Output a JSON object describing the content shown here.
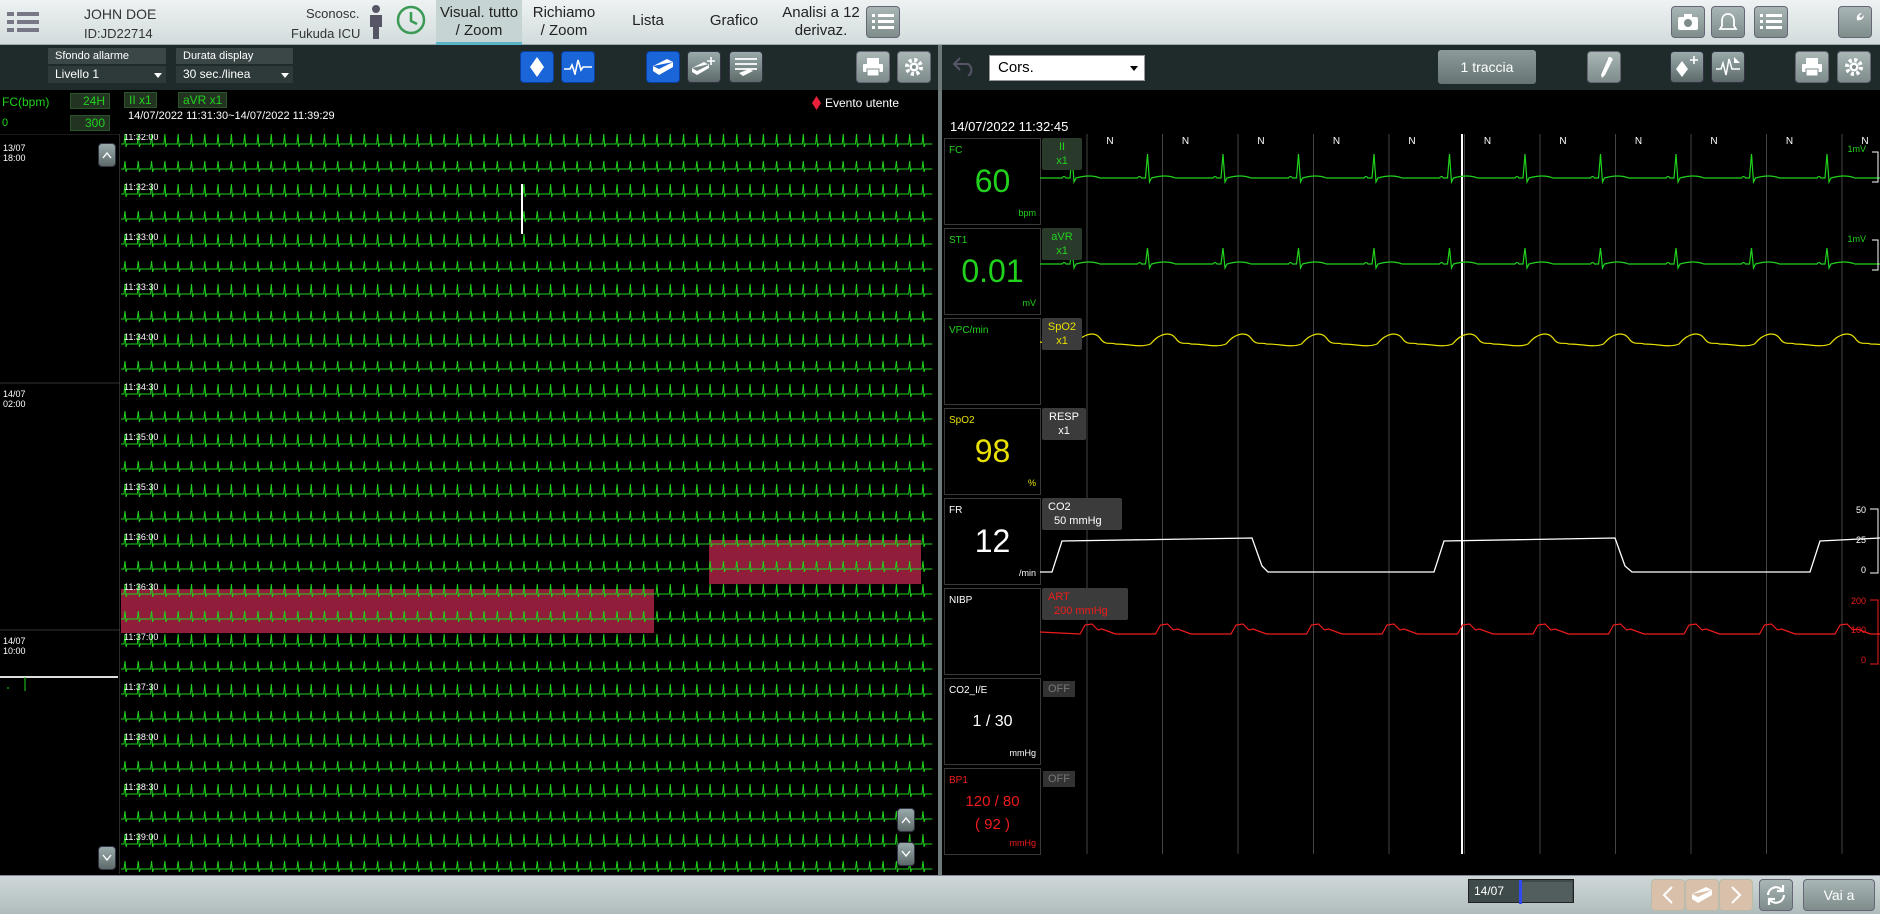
{
  "header": {
    "patient_name": "JOHN DOE",
    "patient_id": "ID:JD22714",
    "gender": "Sconosc.",
    "location": "Fukuda ICU",
    "tabs": [
      {
        "label1": "Visual. tutto",
        "label2": "/ Zoom"
      },
      {
        "label1": "Richiamo",
        "label2": "/ Zoom"
      },
      {
        "label1": "Lista",
        "label2": ""
      },
      {
        "label1": "Grafico",
        "label2": ""
      },
      {
        "label1": "Analisi a 12",
        "label2": "derivaz."
      }
    ]
  },
  "left": {
    "alarm_bg_label": "Sfondo allarme",
    "alarm_bg_value": "Livello 1",
    "display_dur_label": "Durata display",
    "display_dur_value": "30 sec./linea",
    "hr_label": "FC(bpm)",
    "hr_range_btn": "24H",
    "hr_min": "0",
    "hr_max": "300",
    "lead1": "II  x1",
    "lead2": "aVR  x1",
    "time_range": "14/07/2022 11:31:30~14/07/2022 11:39:29",
    "event_legend": "Evento utente",
    "trend_labels": [
      {
        "date": "13/07",
        "time": "18:00"
      },
      {
        "date": "14/07",
        "time": "02:00"
      },
      {
        "date": "14/07",
        "time": "10:00"
      }
    ],
    "row_times": [
      "11:32:00",
      "11:32:30",
      "11:33:00",
      "11:33:30",
      "11:34:00",
      "11:34:30",
      "11:35:00",
      "11:35:30",
      "11:36:00",
      "11:36:30",
      "11:37:00",
      "11:37:30",
      "11:38:00",
      "11:38:30",
      "11:39:00"
    ]
  },
  "right": {
    "trace_select": "Cors.",
    "trace_btn": "1 traccia",
    "timestamp": "14/07/2022 11:32:45",
    "beat_marker": "N",
    "params": [
      {
        "name": "FC",
        "value": "60",
        "unit": "bpm",
        "color": "#21d21d"
      },
      {
        "name": "ST1",
        "value": "0.01",
        "unit": "mV",
        "color": "#21d21d"
      },
      {
        "name": "VPC/min",
        "value": "",
        "unit": "",
        "color": "#21d21d"
      },
      {
        "name": "SpO2",
        "value": "98",
        "unit": "%",
        "color": "#e8e000"
      },
      {
        "name": "FR",
        "value": "12",
        "unit": "/min",
        "color": "#ffffff"
      },
      {
        "name": "NIBP",
        "value": "",
        "unit": "",
        "color": "#ffffff"
      },
      {
        "name": "CO2_I/E",
        "value": "1 / 30",
        "unit": "mmHg",
        "color": "#ffffff"
      },
      {
        "name": "BP1",
        "value": "120 / 80",
        "value2": "( 92 )",
        "unit": "mmHg",
        "color": "#ee1c1c"
      }
    ],
    "wave_labels": [
      {
        "l1": "II",
        "l2": "x1"
      },
      {
        "l1": "aVR",
        "l2": "x1"
      },
      {
        "l1": "SpO2",
        "l2": "x1"
      },
      {
        "l1": "RESP",
        "l2": "x1"
      },
      {
        "l1": "CO2",
        "l2": "50 mmHg"
      },
      {
        "l1": "ART",
        "l2": "200 mmHg"
      }
    ],
    "off_label": "OFF",
    "scale_1mv": "1mV",
    "co2_scale": [
      "50",
      "25",
      "0"
    ],
    "art_scale": [
      "200",
      "100",
      "0"
    ]
  },
  "footer": {
    "date_chip": "14/07",
    "goto_btn": "Vai a"
  }
}
